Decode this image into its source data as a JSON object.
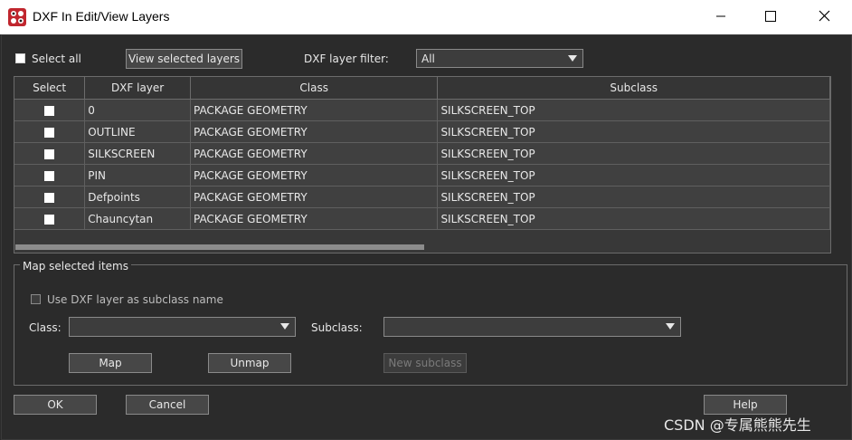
{
  "window": {
    "title": "DXF In Edit/View Layers",
    "icon": "app-icon",
    "controls": {
      "minimize": "minimize-icon",
      "maximize": "maximize-icon",
      "close": "close-icon"
    }
  },
  "toolbar": {
    "select_all_label": "Select all",
    "view_selected_label": "View selected layers",
    "filter_label": "DXF layer filter:",
    "filter_value": "All"
  },
  "table": {
    "headers": [
      "Select",
      "DXF layer",
      "Class",
      "Subclass"
    ],
    "rows": [
      {
        "layer": "0",
        "class": "PACKAGE GEOMETRY",
        "subclass": "SILKSCREEN_TOP"
      },
      {
        "layer": "OUTLINE",
        "class": "PACKAGE GEOMETRY",
        "subclass": "SILKSCREEN_TOP"
      },
      {
        "layer": "SILKSCREEN",
        "class": "PACKAGE GEOMETRY",
        "subclass": "SILKSCREEN_TOP"
      },
      {
        "layer": "PIN",
        "class": "PACKAGE GEOMETRY",
        "subclass": "SILKSCREEN_TOP"
      },
      {
        "layer": "Defpoints",
        "class": "PACKAGE GEOMETRY",
        "subclass": "SILKSCREEN_TOP"
      },
      {
        "layer": "Chauncytan",
        "class": "PACKAGE GEOMETRY",
        "subclass": "SILKSCREEN_TOP"
      }
    ]
  },
  "map_group": {
    "title": "Map selected items",
    "use_dxf_label": "Use DXF layer as subclass name",
    "class_label": "Class:",
    "class_value": "",
    "subclass_label": "Subclass:",
    "subclass_value": "",
    "map_label": "Map",
    "unmap_label": "Unmap",
    "new_subclass_label": "New subclass"
  },
  "footer": {
    "ok_label": "OK",
    "cancel_label": "Cancel",
    "help_label": "Help"
  },
  "watermark": "CSDN @专属熊熊先生",
  "colors": {
    "background": "#2b2b2b",
    "titlebar": "#ffffff",
    "button": "#474747",
    "text": "#e8e8e8"
  }
}
